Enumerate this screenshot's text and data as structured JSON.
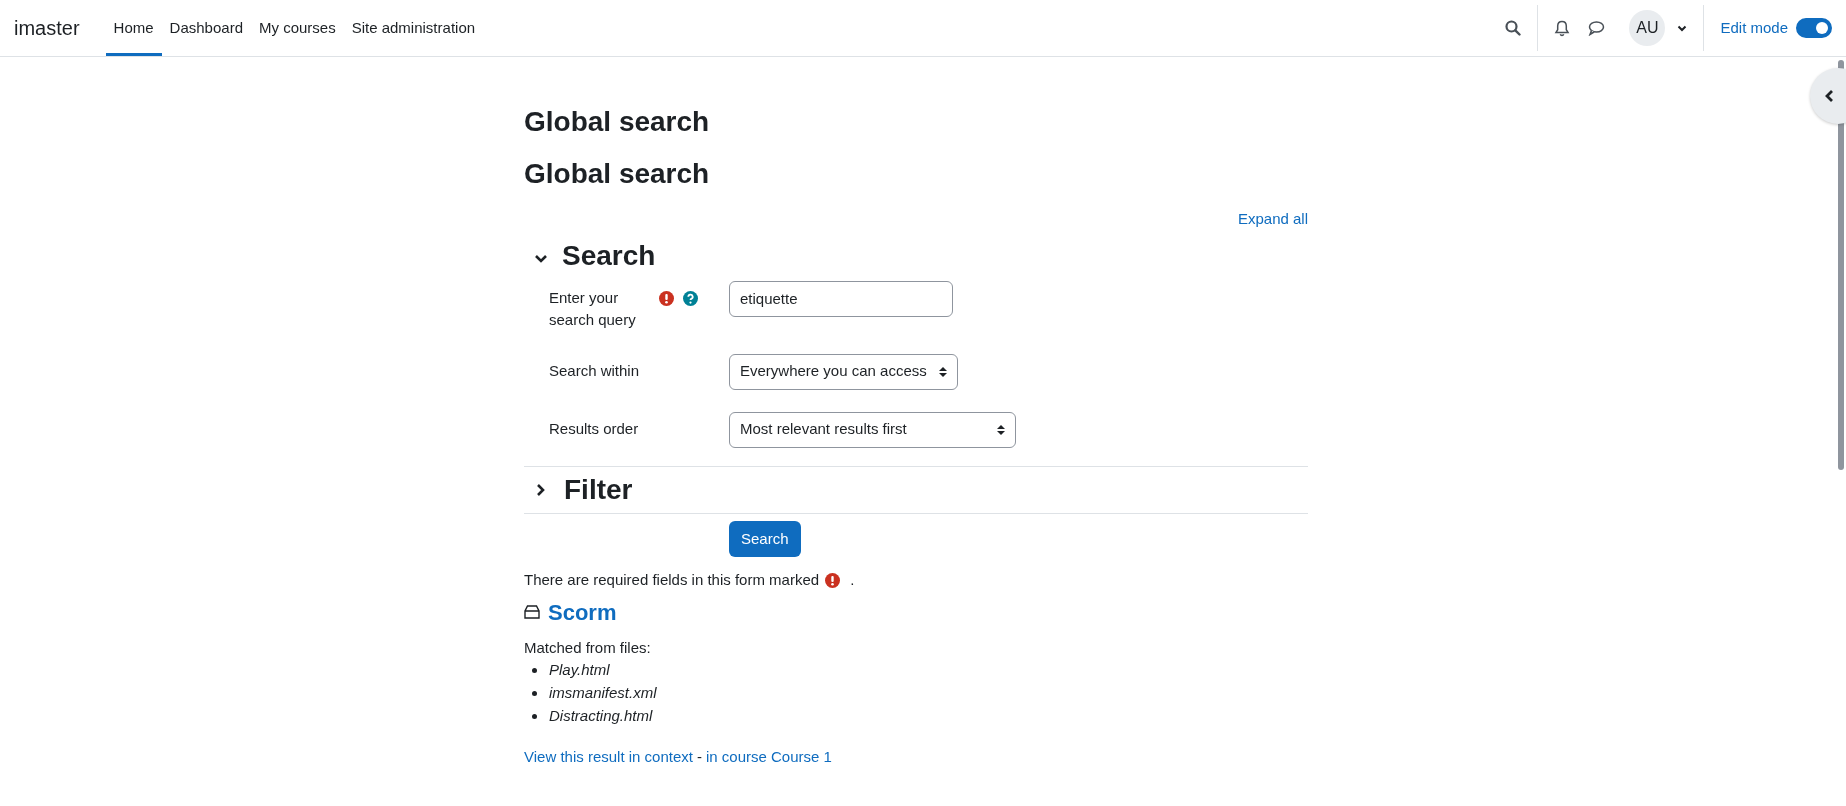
{
  "navbar": {
    "brand": "imaster",
    "items": [
      {
        "label": "Home",
        "selected": true
      },
      {
        "label": "Dashboard",
        "selected": false
      },
      {
        "label": "My courses",
        "selected": false
      },
      {
        "label": "Site administration",
        "selected": false
      }
    ],
    "avatar": "AU",
    "edit_mode": {
      "label": "Edit mode",
      "on": true
    }
  },
  "page_titles": [
    "Global search",
    "Global search"
  ],
  "expand_all": "Expand all",
  "sections": [
    {
      "title": "Search",
      "expanded": true,
      "fields": [
        {
          "kind": "text",
          "label": "Enter your search query",
          "required": true,
          "help": true,
          "value": "etiquette"
        },
        {
          "kind": "select",
          "label": "Search within",
          "required": false,
          "help": false,
          "value": "Everywhere you can access"
        },
        {
          "kind": "select",
          "label": "Results order",
          "required": false,
          "help": false,
          "value": "Most relevant results first"
        }
      ]
    },
    {
      "title": "Filter",
      "expanded": false
    }
  ],
  "submit": "Search",
  "required_note": {
    "before": "There are required fields in this form marked",
    "after": "."
  },
  "results": [
    {
      "title": "Scorm",
      "matched_label": "Matched from files:",
      "files": [
        "Play.html",
        "imsmanifest.xml",
        "Distracting.html"
      ],
      "context_link": "View this result in context",
      "separator": "-",
      "course_link": "in course Course 1"
    }
  ]
}
